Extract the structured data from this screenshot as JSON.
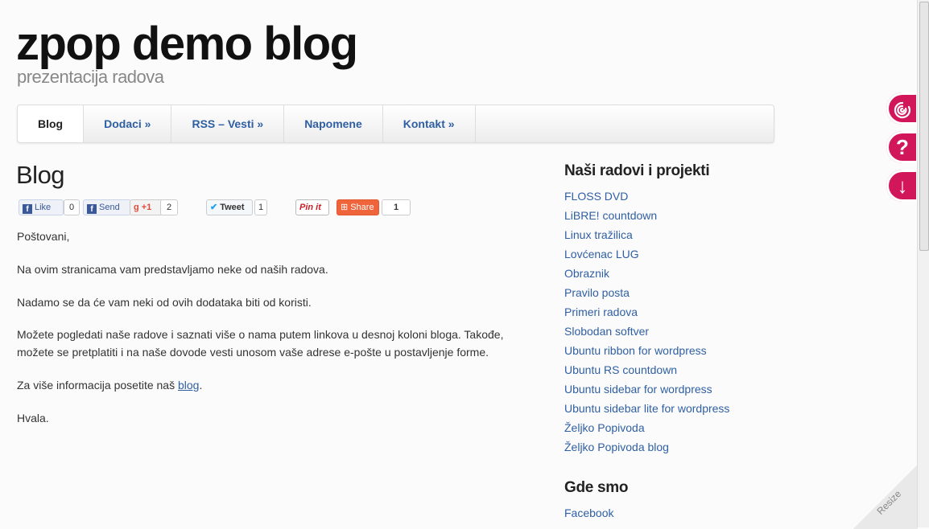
{
  "site": {
    "title": "zpop demo blog",
    "description": "prezentacija radova"
  },
  "nav": {
    "items": [
      {
        "label": "Blog"
      },
      {
        "label": "Dodaci »"
      },
      {
        "label": "RSS – Vesti »"
      },
      {
        "label": "Napomene"
      },
      {
        "label": "Kontakt »"
      }
    ]
  },
  "page": {
    "title": "Blog"
  },
  "social": {
    "like_label": "Like",
    "like_count": "0",
    "send_label": "Send",
    "gplus_label": "+1",
    "gplus_count": "2",
    "tweet_label": "Tweet",
    "tweet_count": "1",
    "pinit_label": "Pin it",
    "share_label": "Share",
    "share_count": "1"
  },
  "content": {
    "greeting": "Poštovani,",
    "p1": "Na ovim stranicama vam predstavljamo neke od naših radova.",
    "p2": "Nadamo se da će vam neki od ovih dodataka biti od koristi.",
    "p3": "Možete pogledati naše radove i saznati više o nama putem linkova u desnoj koloni bloga. Takođe, možete se pretplatiti i na naše dovode vesti unosom vaše adrese e-pošte u postavljenje forme.",
    "p4_prefix": "Za više informacija posetite naš ",
    "p4_link": "blog",
    "p4_suffix": ".",
    "closing": "Hvala."
  },
  "sidebar": {
    "projects_title": "Naši radovi i projekti",
    "projects": [
      "FLOSS DVD",
      "LiBRE! countdown",
      "Linux tražilica",
      "Lovćenac LUG",
      "Obraznik",
      "Pravilo posta",
      "Primeri radova",
      "Slobodan softver",
      "Ubuntu ribbon for wordpress",
      "Ubuntu RS countdown",
      "Ubuntu sidebar for wordpress",
      "Ubuntu sidebar lite for wordpress",
      "Željko Popivoda",
      "Željko Popivoda blog"
    ],
    "where_title": "Gde smo",
    "where_link": "Facebook"
  },
  "floating": {
    "help_glyph": "?",
    "down_glyph": "↓"
  },
  "resize_label": "Resize",
  "colors": {
    "accent": "#d1175a",
    "link": "#2f5fa3"
  }
}
